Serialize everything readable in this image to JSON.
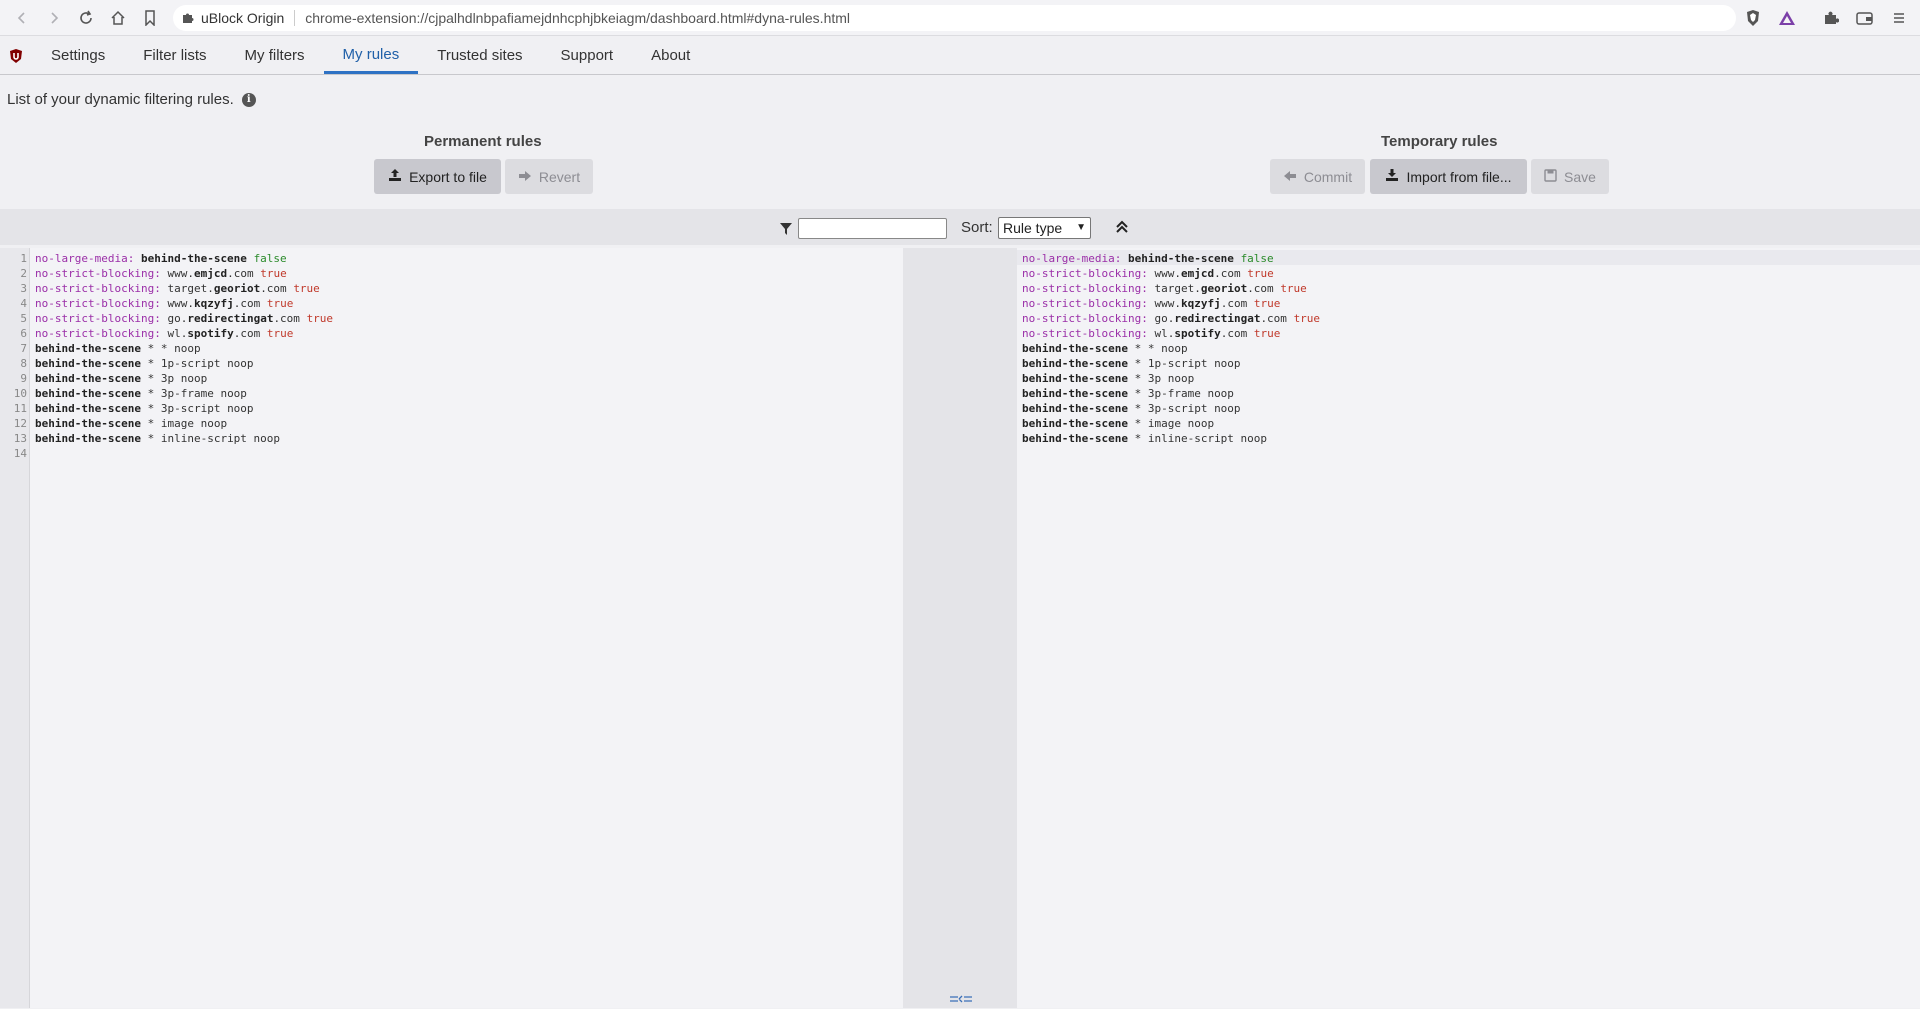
{
  "browser": {
    "extension_name": "uBlock Origin",
    "url": "chrome-extension://cjpalhdlnbpafiamejdnhcphjbkeiagm/dashboard.html#dyna-rules.html"
  },
  "tabs": [
    {
      "label": "Settings"
    },
    {
      "label": "Filter lists"
    },
    {
      "label": "My filters"
    },
    {
      "label": "My rules"
    },
    {
      "label": "Trusted sites"
    },
    {
      "label": "Support"
    },
    {
      "label": "About"
    }
  ],
  "intro": {
    "text": "List of your dynamic filtering rules."
  },
  "permanent": {
    "title": "Permanent rules",
    "export_label": "Export to file",
    "revert_label": "Revert"
  },
  "temporary": {
    "title": "Temporary rules",
    "commit_label": "Commit",
    "import_label": "Import from file...",
    "save_label": "Save"
  },
  "toolbar": {
    "sort_label": "Sort:",
    "sort_value": "Rule type"
  },
  "permanent_rules": [
    {
      "ln": "1",
      "a": "no-large-media:",
      "b": "behind-the-scene",
      "c": "false",
      "c_kind": "green"
    },
    {
      "ln": "2",
      "a": "no-strict-blocking:",
      "b": "www.",
      "b2": "emjcd",
      "b3": ".com",
      "c": "true",
      "c_kind": "red"
    },
    {
      "ln": "3",
      "a": "no-strict-blocking:",
      "b": "target.",
      "b2": "georiot",
      "b3": ".com",
      "c": "true",
      "c_kind": "red"
    },
    {
      "ln": "4",
      "a": "no-strict-blocking:",
      "b": "www.",
      "b2": "kqzyfj",
      "b3": ".com",
      "c": "true",
      "c_kind": "red"
    },
    {
      "ln": "5",
      "a": "no-strict-blocking:",
      "b": "go.",
      "b2": "redirectingat",
      "b3": ".com",
      "c": "true",
      "c_kind": "red"
    },
    {
      "ln": "6",
      "a": "no-strict-blocking:",
      "b": "wl.",
      "b2": "spotify",
      "b3": ".com",
      "c": "true",
      "c_kind": "red"
    },
    {
      "ln": "7",
      "a": "behind-the-scene",
      "b": "* * noop"
    },
    {
      "ln": "8",
      "a": "behind-the-scene",
      "b": "* 1p-script noop"
    },
    {
      "ln": "9",
      "a": "behind-the-scene",
      "b": "* 3p noop"
    },
    {
      "ln": "10",
      "a": "behind-the-scene",
      "b": "* 3p-frame noop"
    },
    {
      "ln": "11",
      "a": "behind-the-scene",
      "b": "* 3p-script noop"
    },
    {
      "ln": "12",
      "a": "behind-the-scene",
      "b": "* image noop"
    },
    {
      "ln": "13",
      "a": "behind-the-scene",
      "b": "* inline-script noop"
    },
    {
      "ln": "14",
      "a": "",
      "b": ""
    }
  ],
  "colors": {
    "accent": "#2e72c4",
    "keyword": "#9b2fa8",
    "true": "#c0392b",
    "false": "#2a8a2a"
  }
}
